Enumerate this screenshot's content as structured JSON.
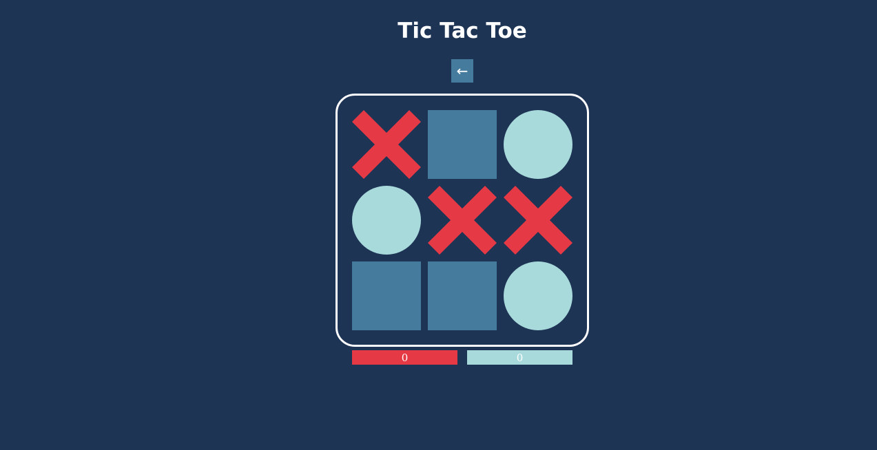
{
  "title": "Tic Tac Toe",
  "back_button": {
    "label": "←",
    "icon": "arrow-left-icon"
  },
  "board": {
    "cells": [
      "X",
      "",
      "O",
      "O",
      "X",
      "X",
      "",
      "",
      "O"
    ]
  },
  "scores": {
    "x": "0",
    "o": "0"
  },
  "colors": {
    "background": "#1e3455",
    "x_mark": "#e63946",
    "o_mark": "#a8dadc",
    "empty_cell": "#457b9d",
    "board_border": "#ffffff"
  }
}
